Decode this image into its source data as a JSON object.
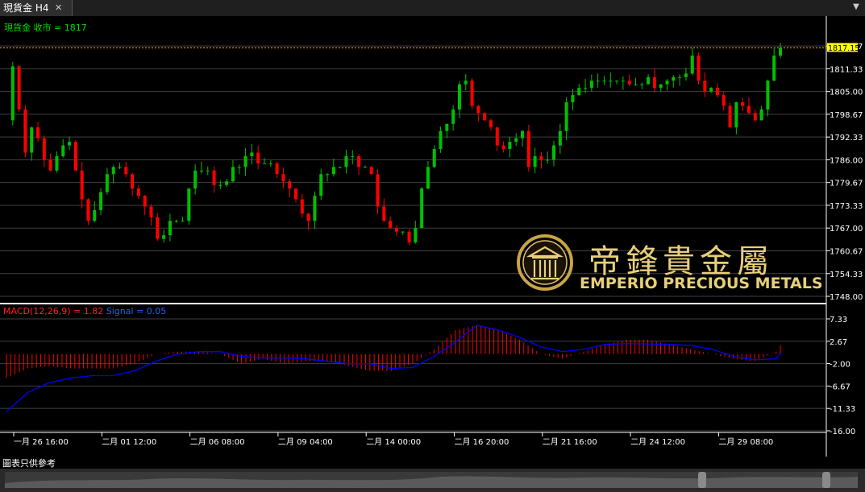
{
  "window": {
    "tab_title": "現貨金 H4",
    "close_glyph": "✕",
    "menu_glyph": "▼"
  },
  "footer": {
    "disclaimer": "圖表只供參考"
  },
  "logo": {
    "chinese": "帝鋒貴金屬",
    "english": "EMPERIO PRECIOUS METALS"
  },
  "chart_data": [
    {
      "type": "candlestick",
      "label": "現貨金 收市 = 1817",
      "current_price_label": "1817.15",
      "y_tick_labels": [
        "1817.67",
        "1811.33",
        "1805.00",
        "1798.67",
        "1792.33",
        "1786.00",
        "1779.67",
        "1773.33",
        "1767.00",
        "1760.67",
        "1754.33",
        "1748.00"
      ],
      "ylim": [
        1748.0,
        1821.5
      ],
      "current_price": 1817.15,
      "x_tick_labels": [
        "一月 26 16:00",
        "二月 01 12:00",
        "二月 06 08:00",
        "二月 09 04:00",
        "二月 14 00:00",
        "二月 16 20:00",
        "二月 21 16:00",
        "二月 24 12:00",
        "二月 29 08:00"
      ],
      "colors": {
        "up": "#00c000",
        "down": "#ff0000",
        "price_line": "#ffa500",
        "label": "#00dd00"
      },
      "price_path": [
        [
          0,
          1797
        ],
        [
          1,
          1812
        ],
        [
          2,
          1800
        ],
        [
          3,
          1788
        ],
        [
          4,
          1795
        ],
        [
          5,
          1792
        ],
        [
          6,
          1786
        ],
        [
          7,
          1783
        ],
        [
          8,
          1787
        ],
        [
          9,
          1790
        ],
        [
          10,
          1791
        ],
        [
          11,
          1783
        ],
        [
          12,
          1775
        ],
        [
          13,
          1769
        ],
        [
          14,
          1772
        ],
        [
          15,
          1777
        ],
        [
          16,
          1782
        ],
        [
          17,
          1784
        ],
        [
          18,
          1784
        ],
        [
          19,
          1782
        ],
        [
          20,
          1778
        ],
        [
          21,
          1776
        ],
        [
          22,
          1773
        ],
        [
          23,
          1770
        ],
        [
          24,
          1764
        ],
        [
          25,
          1765
        ],
        [
          26,
          1769
        ],
        [
          27,
          1769
        ],
        [
          28,
          1769
        ],
        [
          29,
          1778
        ],
        [
          30,
          1783
        ],
        [
          31,
          1783
        ],
        [
          32,
          1783
        ],
        [
          33,
          1779
        ],
        [
          34,
          1779
        ],
        [
          35,
          1780
        ],
        [
          36,
          1784
        ],
        [
          37,
          1784
        ],
        [
          38,
          1787
        ],
        [
          39,
          1788
        ],
        [
          40,
          1785
        ],
        [
          41,
          1785
        ],
        [
          42,
          1785
        ],
        [
          43,
          1782
        ],
        [
          44,
          1780
        ],
        [
          45,
          1778
        ],
        [
          46,
          1775
        ],
        [
          47,
          1771
        ],
        [
          48,
          1769
        ],
        [
          49,
          1776
        ],
        [
          50,
          1782
        ],
        [
          51,
          1782
        ],
        [
          52,
          1784
        ],
        [
          53,
          1784
        ],
        [
          54,
          1787
        ],
        [
          55,
          1787
        ],
        [
          56,
          1784
        ],
        [
          57,
          1784
        ],
        [
          58,
          1782
        ],
        [
          59,
          1773
        ],
        [
          60,
          1769
        ],
        [
          61,
          1767
        ],
        [
          62,
          1766
        ],
        [
          63,
          1766
        ],
        [
          64,
          1763
        ],
        [
          65,
          1767
        ],
        [
          66,
          1778
        ],
        [
          67,
          1784
        ],
        [
          68,
          1789
        ],
        [
          69,
          1794
        ],
        [
          70,
          1796
        ],
        [
          71,
          1800
        ],
        [
          72,
          1807
        ],
        [
          73,
          1808
        ],
        [
          74,
          1801
        ],
        [
          75,
          1799
        ],
        [
          76,
          1797
        ],
        [
          77,
          1795
        ],
        [
          78,
          1790
        ],
        [
          79,
          1789
        ],
        [
          80,
          1791
        ],
        [
          81,
          1792
        ],
        [
          82,
          1794
        ],
        [
          83,
          1784
        ],
        [
          84,
          1787
        ],
        [
          85,
          1786
        ],
        [
          86,
          1786
        ],
        [
          87,
          1790
        ],
        [
          88,
          1794
        ],
        [
          89,
          1802
        ],
        [
          90,
          1804
        ],
        [
          91,
          1806
        ],
        [
          92,
          1806
        ],
        [
          93,
          1808
        ],
        [
          94,
          1808
        ],
        [
          95,
          1808
        ],
        [
          96,
          1808
        ],
        [
          97,
          1808
        ],
        [
          98,
          1808
        ],
        [
          99,
          1807
        ],
        [
          100,
          1807
        ],
        [
          101,
          1807
        ],
        [
          102,
          1809
        ],
        [
          103,
          1806
        ],
        [
          104,
          1807
        ],
        [
          105,
          1808
        ],
        [
          106,
          1809
        ],
        [
          107,
          1809
        ],
        [
          108,
          1810
        ],
        [
          109,
          1815
        ],
        [
          110,
          1808
        ],
        [
          111,
          1805
        ],
        [
          112,
          1806
        ],
        [
          113,
          1804
        ],
        [
          114,
          1801
        ],
        [
          115,
          1795
        ],
        [
          116,
          1802
        ],
        [
          117,
          1801
        ],
        [
          118,
          1799
        ],
        [
          119,
          1797
        ],
        [
          120,
          1800
        ],
        [
          121,
          1808
        ],
        [
          122,
          1815
        ],
        [
          123,
          1817.15
        ]
      ]
    },
    {
      "type": "bar",
      "label": "MACD(12,26,9) = 1.82",
      "signal_label": "Signal = 0.05",
      "y_tick_labels": [
        "7.33",
        "2.67",
        "-2.00",
        "-6.67",
        "-11.33",
        "-16.00"
      ],
      "ylim": [
        -16.0,
        7.33
      ],
      "colors": {
        "histogram": "#ff0000",
        "signal": "#0000ff",
        "label_main": "#ff2020",
        "label_signal": "#2060ff"
      },
      "macd_path": [
        [
          0,
          -5
        ],
        [
          5,
          -3
        ],
        [
          10,
          -2.5
        ],
        [
          15,
          -3
        ],
        [
          20,
          -3
        ],
        [
          25,
          -3
        ],
        [
          30,
          -2
        ],
        [
          35,
          0
        ],
        [
          40,
          0.5
        ],
        [
          45,
          0.5
        ],
        [
          50,
          0
        ],
        [
          55,
          -2
        ],
        [
          60,
          -1
        ],
        [
          65,
          -2
        ],
        [
          70,
          -1.5
        ],
        [
          75,
          -1.5
        ],
        [
          80,
          -2.5
        ],
        [
          85,
          -3.5
        ],
        [
          90,
          -3.5
        ],
        [
          95,
          -2
        ],
        [
          100,
          1
        ],
        [
          105,
          5
        ],
        [
          110,
          6
        ],
        [
          115,
          5
        ],
        [
          120,
          3
        ],
        [
          125,
          0
        ],
        [
          130,
          -1
        ],
        [
          135,
          0.5
        ],
        [
          140,
          2
        ],
        [
          145,
          3
        ],
        [
          150,
          3
        ],
        [
          155,
          2
        ],
        [
          160,
          1
        ],
        [
          165,
          0
        ],
        [
          170,
          -1
        ],
        [
          175,
          -1.5
        ],
        [
          180,
          0.5
        ],
        [
          181,
          1.82
        ]
      ],
      "signal_path": [
        [
          0,
          -12
        ],
        [
          5,
          -8
        ],
        [
          10,
          -6
        ],
        [
          15,
          -5
        ],
        [
          20,
          -4.5
        ],
        [
          25,
          -4.5
        ],
        [
          30,
          -3.5
        ],
        [
          35,
          -1.5
        ],
        [
          40,
          0
        ],
        [
          45,
          0.5
        ],
        [
          50,
          0.5
        ],
        [
          55,
          -0.5
        ],
        [
          60,
          -0.8
        ],
        [
          65,
          -0.8
        ],
        [
          70,
          -1
        ],
        [
          75,
          -1.5
        ],
        [
          80,
          -2
        ],
        [
          85,
          -2
        ],
        [
          90,
          -3
        ],
        [
          95,
          -2.8
        ],
        [
          100,
          -0.5
        ],
        [
          105,
          2.5
        ],
        [
          110,
          6
        ],
        [
          115,
          5
        ],
        [
          120,
          3.5
        ],
        [
          125,
          1.5
        ],
        [
          130,
          0.5
        ],
        [
          135,
          1
        ],
        [
          140,
          2
        ],
        [
          145,
          2.2
        ],
        [
          150,
          2.1
        ],
        [
          155,
          2
        ],
        [
          160,
          1.8
        ],
        [
          165,
          1
        ],
        [
          170,
          -0.5
        ],
        [
          175,
          -1.2
        ],
        [
          180,
          -1
        ],
        [
          181,
          0.05
        ]
      ]
    }
  ]
}
